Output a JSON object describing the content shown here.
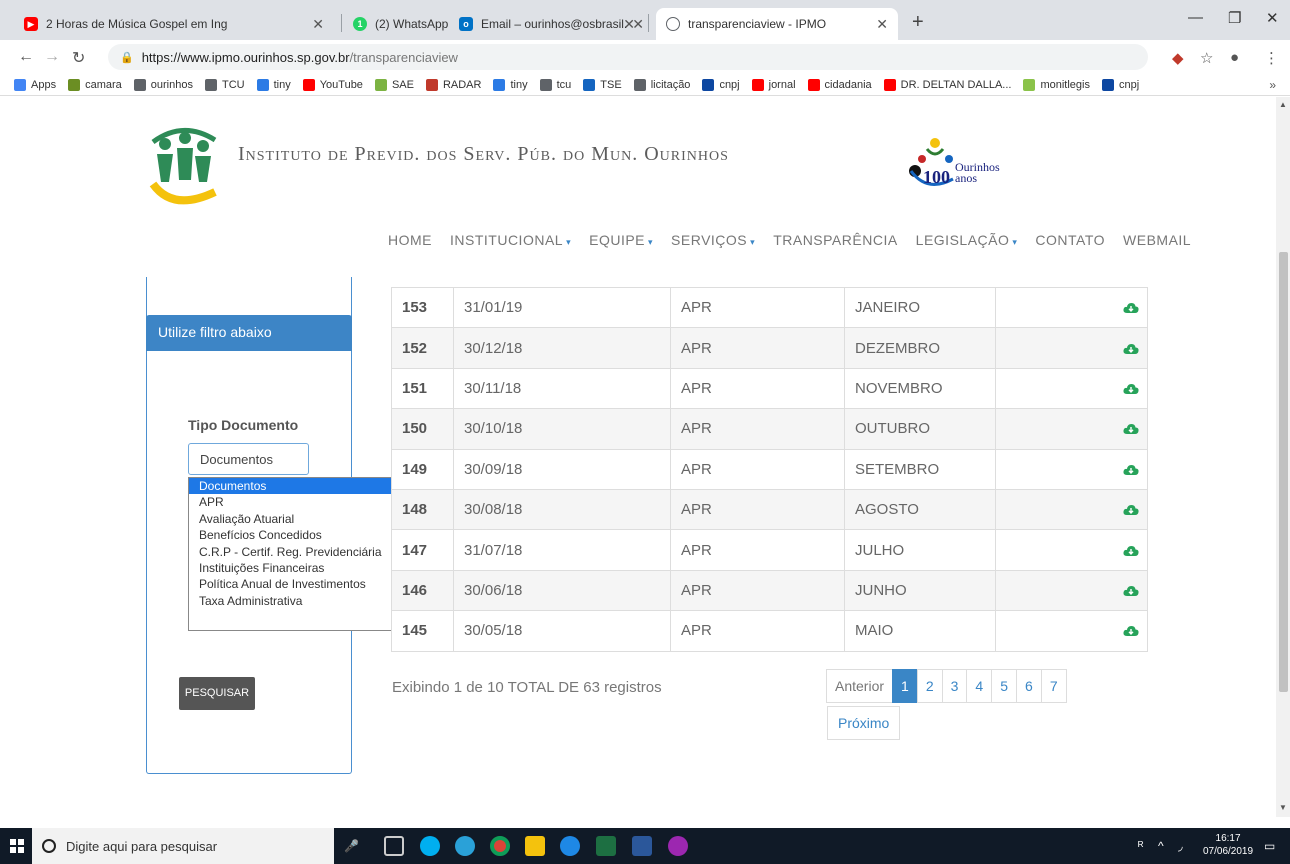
{
  "browser": {
    "tabs": [
      {
        "title": "2 Horas de Música Gospel em Ing",
        "favicon": "youtube-icon",
        "color": "#ff0000"
      },
      {
        "title": "(2) WhatsApp",
        "favicon": "whatsapp-icon",
        "color": "#25d366",
        "badge": "1"
      },
      {
        "title": "Email – ourinhos@osbrasil.org.br",
        "favicon": "outlook-icon",
        "color": "#0072c6"
      },
      {
        "title": "transparenciaview - IPMO",
        "favicon": "globe-icon",
        "color": "#5f6368"
      }
    ],
    "url_host": "https://www.ipmo.ourinhos.sp.gov.br",
    "url_path": "/transparenciaview",
    "bookmarks": [
      {
        "label": "Apps",
        "icon": "apps-icon",
        "color": "#4285f4"
      },
      {
        "label": "camara",
        "icon": "camara-icon",
        "color": "#6b8e23"
      },
      {
        "label": "ourinhos",
        "icon": "globe-icon",
        "color": "#5f6368"
      },
      {
        "label": "TCU",
        "icon": "globe-icon",
        "color": "#5f6368"
      },
      {
        "label": "tiny",
        "icon": "tiny-icon",
        "color": "#2c7be5"
      },
      {
        "label": "YouTube",
        "icon": "youtube-icon",
        "color": "#ff0000"
      },
      {
        "label": "SAE",
        "icon": "sae-icon",
        "color": "#7cb342"
      },
      {
        "label": "RADAR",
        "icon": "radar-icon",
        "color": "#c0392b"
      },
      {
        "label": "tiny",
        "icon": "tiny-icon",
        "color": "#2c7be5"
      },
      {
        "label": "tcu",
        "icon": "globe-icon",
        "color": "#5f6368"
      },
      {
        "label": "TSE",
        "icon": "tse-icon",
        "color": "#1565c0"
      },
      {
        "label": "licitação",
        "icon": "globe-icon",
        "color": "#5f6368"
      },
      {
        "label": "cnpj",
        "icon": "receita-icon",
        "color": "#0d47a1"
      },
      {
        "label": "jornal",
        "icon": "youtube-icon",
        "color": "#ff0000"
      },
      {
        "label": "cidadania",
        "icon": "youtube-icon",
        "color": "#ff0000"
      },
      {
        "label": "DR. DELTAN DALLA...",
        "icon": "youtube-icon",
        "color": "#ff0000"
      },
      {
        "label": "monitlegis",
        "icon": "monitlegis-icon",
        "color": "#8bc34a"
      },
      {
        "label": "cnpj",
        "icon": "receita-icon",
        "color": "#0d47a1"
      }
    ],
    "more_bookmarks": "»"
  },
  "site": {
    "title": "Instituto de Previd. dos Serv. Púb. do Mun. Ourinhos",
    "badge_lines": [
      "Ourinhos",
      "anos"
    ],
    "badge_number": "100",
    "nav": [
      {
        "label": "HOME",
        "has_caret": false
      },
      {
        "label": "INSTITUCIONAL",
        "has_caret": true
      },
      {
        "label": "EQUIPE",
        "has_caret": true
      },
      {
        "label": "SERVIÇOS",
        "has_caret": true
      },
      {
        "label": "TRANSPARÊNCIA",
        "has_caret": false
      },
      {
        "label": "LEGISLAÇÃO",
        "has_caret": true
      },
      {
        "label": "CONTATO",
        "has_caret": false
      },
      {
        "label": "WEBMAIL",
        "has_caret": false
      }
    ],
    "caret": "▾"
  },
  "filter": {
    "heading": "Utilize filtro abaixo",
    "tipo_label": "Tipo Documento",
    "selected_value": "Documentos",
    "options": [
      "Documentos",
      "APR",
      "Avaliação Atuarial",
      "Benefícios Concedidos",
      "C.R.P - Certif. Reg. Previdenciária",
      "Instituições Financeiras",
      "Política Anual de Investimentos",
      "Taxa Administrativa"
    ],
    "search_button": "PESQUISAR"
  },
  "table": {
    "rows": [
      {
        "num": "153",
        "date": "31/01/19",
        "type": "APR",
        "month": "JANEIRO"
      },
      {
        "num": "152",
        "date": "30/12/18",
        "type": "APR",
        "month": "DEZEMBRO"
      },
      {
        "num": "151",
        "date": "30/11/18",
        "type": "APR",
        "month": "NOVEMBRO"
      },
      {
        "num": "150",
        "date": "30/10/18",
        "type": "APR",
        "month": "OUTUBRO"
      },
      {
        "num": "149",
        "date": "30/09/18",
        "type": "APR",
        "month": "SETEMBRO"
      },
      {
        "num": "148",
        "date": "30/08/18",
        "type": "APR",
        "month": "AGOSTO"
      },
      {
        "num": "147",
        "date": "31/07/18",
        "type": "APR",
        "month": "JULHO"
      },
      {
        "num": "146",
        "date": "30/06/18",
        "type": "APR",
        "month": "JUNHO"
      },
      {
        "num": "145",
        "date": "30/05/18",
        "type": "APR",
        "month": "MAIO"
      }
    ],
    "download_color": "#27a35a"
  },
  "pagination": {
    "summary": "Exibindo 1 de 10 TOTAL DE 63 registros",
    "prev": "Anterior",
    "pages": [
      "1",
      "2",
      "3",
      "4",
      "5",
      "6",
      "7"
    ],
    "active_page": "1",
    "next": "Próximo"
  },
  "taskbar": {
    "search_placeholder": "Digite aqui para pesquisar",
    "time": "16:17",
    "date": "07/06/2019"
  }
}
